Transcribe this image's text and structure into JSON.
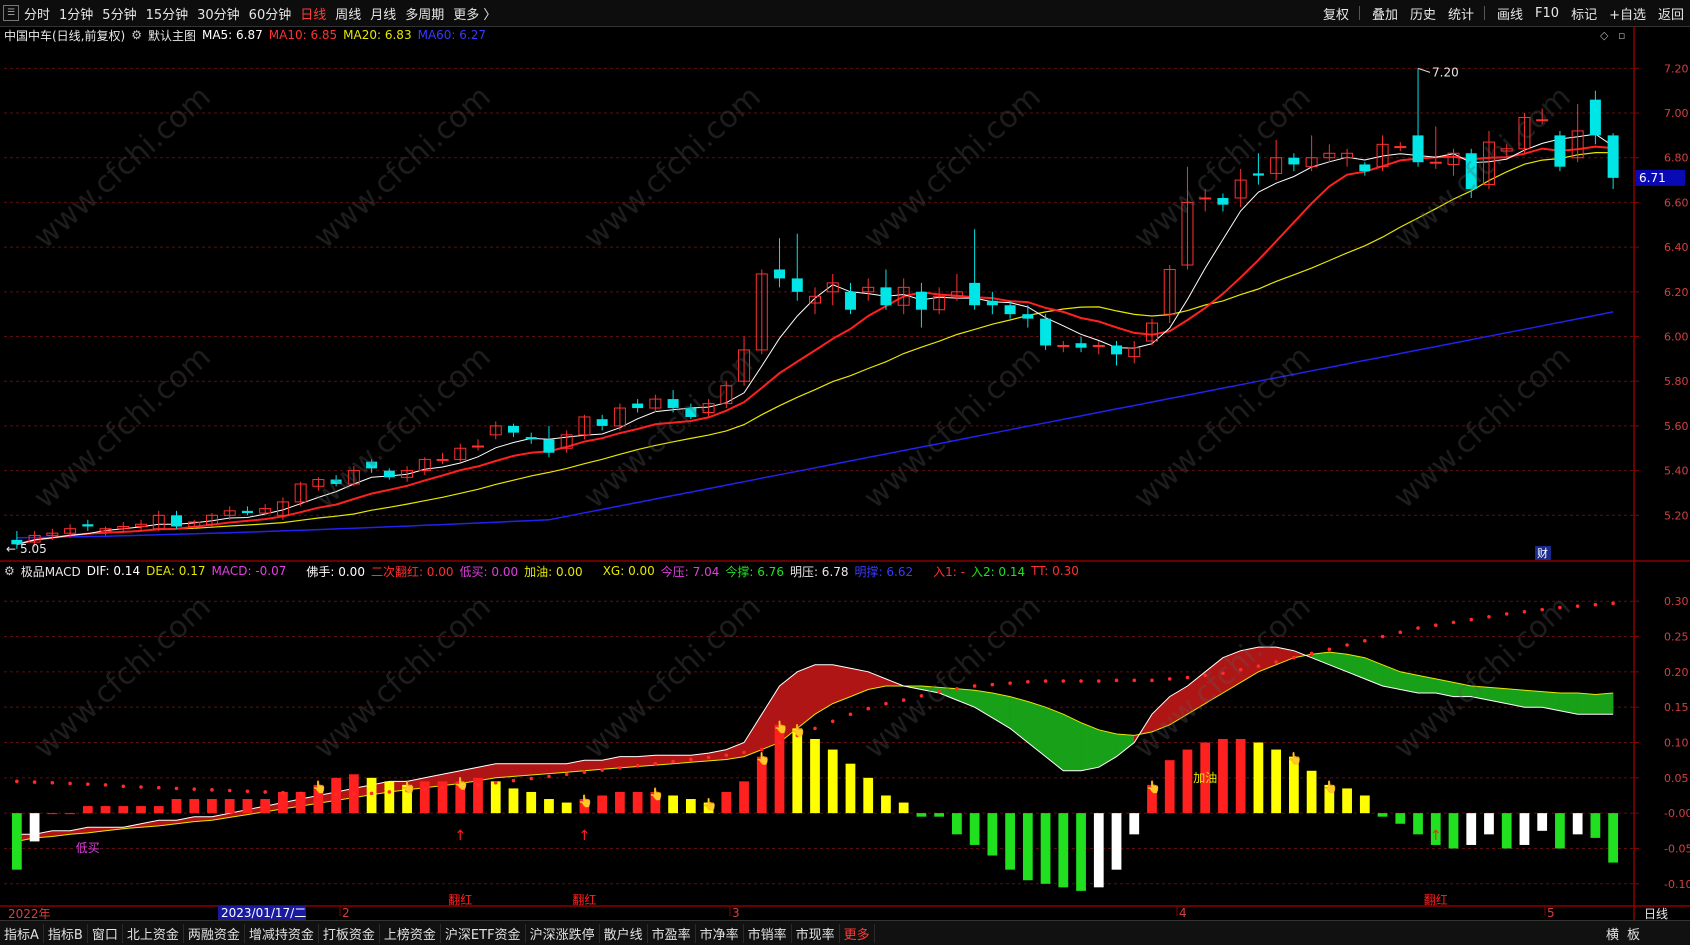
{
  "topbar": {
    "sys_icon": "menu-icon",
    "periods": [
      "分时",
      "1分钟",
      "5分钟",
      "15分钟",
      "30分钟",
      "60分钟",
      "日线",
      "周线",
      "月线",
      "多周期",
      "更多 〉"
    ],
    "active_period": "日线",
    "tools": [
      "复权",
      "叠加",
      "历史",
      "统计",
      "画线",
      "F10",
      "标记",
      "+自选",
      "返回"
    ]
  },
  "main_header": {
    "title": "中国中车(日线,前复权)",
    "indicator": "默认主图",
    "ma5": "MA5: 6.87",
    "ma10": "MA10: 6.85",
    "ma20": "MA20: 6.83",
    "ma60": "MA60: 6.27",
    "colors": {
      "ma5": "#ffffff",
      "ma10": "#ff2020",
      "ma20": "#e6e600",
      "ma60": "#2020ff"
    }
  },
  "main_axis": {
    "labels": [
      "7.20",
      "7.00",
      "6.80",
      "6.60",
      "6.40",
      "6.20",
      "6.00",
      "5.80",
      "5.60",
      "5.40",
      "5.20"
    ],
    "ymin": 5.0,
    "ymax": 7.3
  },
  "price_tag": "6.71",
  "max_label": "7.20",
  "min_label": "5.05",
  "fin_badge": "财",
  "watermark": "www.cfchi.com",
  "macd_header": {
    "name": "极品MACD",
    "dif": "DIF: 0.14",
    "dea": "DEA: 0.17",
    "macd": "MACD: -0.07",
    "foshou": "佛手: 0.00",
    "erci": "二次翻红: 0.00",
    "dimai": "低买: 0.00",
    "jiayou": "加油: 0.00",
    "xg": "XG: 0.00",
    "jinya": "今压: 7.04",
    "jincheng": "今撑: 6.76",
    "mingya": "明压: 6.78",
    "mingcheng": "明撑: 6.62",
    "ru1": "入1: -",
    "ru2": "入2: 0.14",
    "tt": "TT: 0.30"
  },
  "macd_axis": {
    "labels": [
      "0.30",
      "0.25",
      "0.20",
      "0.15",
      "0.10",
      "0.05",
      "-0.00",
      "-0.05",
      "-0.10"
    ],
    "ymin": -0.13,
    "ymax": 0.33
  },
  "macd_marks": {
    "dimai": "低买",
    "jiayou": "加油",
    "fanhong": "翻红"
  },
  "time_axis": {
    "start": "2022年",
    "cursor": "2023/01/17/二",
    "months": [
      "2",
      "3",
      "4",
      "5"
    ],
    "period_label": "日线"
  },
  "bottombar": {
    "items": [
      "指标A",
      "指标B",
      "窗口",
      "北上资金",
      "两融资金",
      "增减持资金",
      "打板资金",
      "上榜资金",
      "沪深ETF资金",
      "沪深涨跌停",
      "散户线",
      "市盈率",
      "市净率",
      "市销率",
      "市现率",
      "更多"
    ],
    "right": [
      "横",
      "板"
    ]
  },
  "chart_data": {
    "type": "candlestick",
    "title": "中国中车(日线,前复权)",
    "x_start": "2022年",
    "candles": [
      [
        5.09,
        5.07,
        5.13,
        5.05
      ],
      [
        5.08,
        5.11,
        5.13,
        5.06
      ],
      [
        5.11,
        5.12,
        5.14,
        5.09
      ],
      [
        5.12,
        5.14,
        5.16,
        5.1
      ],
      [
        5.16,
        5.15,
        5.18,
        5.13
      ],
      [
        5.13,
        5.14,
        5.15,
        5.11
      ],
      [
        5.14,
        5.15,
        5.17,
        5.12
      ],
      [
        5.15,
        5.16,
        5.18,
        5.13
      ],
      [
        5.14,
        5.2,
        5.22,
        5.13
      ],
      [
        5.2,
        5.15,
        5.22,
        5.14
      ],
      [
        5.15,
        5.17,
        5.18,
        5.14
      ],
      [
        5.16,
        5.2,
        5.21,
        5.15
      ],
      [
        5.2,
        5.22,
        5.24,
        5.18
      ],
      [
        5.22,
        5.21,
        5.24,
        5.2
      ],
      [
        5.21,
        5.23,
        5.25,
        5.2
      ],
      [
        5.2,
        5.26,
        5.28,
        5.18
      ],
      [
        5.26,
        5.34,
        5.35,
        5.24
      ],
      [
        5.33,
        5.36,
        5.37,
        5.31
      ],
      [
        5.36,
        5.34,
        5.38,
        5.33
      ],
      [
        5.34,
        5.4,
        5.42,
        5.33
      ],
      [
        5.44,
        5.41,
        5.45,
        5.39
      ],
      [
        5.4,
        5.37,
        5.41,
        5.36
      ],
      [
        5.37,
        5.4,
        5.42,
        5.35
      ],
      [
        5.4,
        5.45,
        5.46,
        5.38
      ],
      [
        5.45,
        5.45,
        5.48,
        5.43
      ],
      [
        5.45,
        5.5,
        5.52,
        5.44
      ],
      [
        5.51,
        5.51,
        5.54,
        5.49
      ],
      [
        5.56,
        5.6,
        5.62,
        5.54
      ],
      [
        5.6,
        5.57,
        5.61,
        5.55
      ],
      [
        5.55,
        5.54,
        5.57,
        5.52
      ],
      [
        5.54,
        5.48,
        5.6,
        5.46
      ],
      [
        5.5,
        5.56,
        5.58,
        5.48
      ],
      [
        5.56,
        5.64,
        5.65,
        5.54
      ],
      [
        5.63,
        5.6,
        5.65,
        5.58
      ],
      [
        5.6,
        5.68,
        5.7,
        5.58
      ],
      [
        5.7,
        5.68,
        5.72,
        5.66
      ],
      [
        5.68,
        5.72,
        5.74,
        5.66
      ],
      [
        5.72,
        5.68,
        5.76,
        5.66
      ],
      [
        5.68,
        5.64,
        5.7,
        5.63
      ],
      [
        5.66,
        5.7,
        5.72,
        5.64
      ],
      [
        5.7,
        5.78,
        5.8,
        5.68
      ],
      [
        5.8,
        5.94,
        6.0,
        5.78
      ],
      [
        5.94,
        6.28,
        6.3,
        5.92
      ],
      [
        6.3,
        6.26,
        6.44,
        6.22
      ],
      [
        6.26,
        6.2,
        6.46,
        6.16
      ],
      [
        6.15,
        6.18,
        6.22,
        6.1
      ],
      [
        6.2,
        6.24,
        6.28,
        6.14
      ],
      [
        6.2,
        6.12,
        6.24,
        6.1
      ],
      [
        6.2,
        6.22,
        6.26,
        6.16
      ],
      [
        6.22,
        6.14,
        6.3,
        6.12
      ],
      [
        6.14,
        6.22,
        6.26,
        6.1
      ],
      [
        6.2,
        6.12,
        6.24,
        6.04
      ],
      [
        6.12,
        6.18,
        6.22,
        6.1
      ],
      [
        6.18,
        6.2,
        6.28,
        6.16
      ],
      [
        6.24,
        6.14,
        6.48,
        6.12
      ],
      [
        6.16,
        6.14,
        6.2,
        6.1
      ],
      [
        6.14,
        6.1,
        6.16,
        6.08
      ],
      [
        6.1,
        6.08,
        6.14,
        6.04
      ],
      [
        6.08,
        5.96,
        6.1,
        5.94
      ],
      [
        5.96,
        5.96,
        5.98,
        5.93
      ],
      [
        5.97,
        5.95,
        6.0,
        5.93
      ],
      [
        5.96,
        5.96,
        5.98,
        5.92
      ],
      [
        5.96,
        5.92,
        5.98,
        5.87
      ],
      [
        5.91,
        5.95,
        5.98,
        5.88
      ],
      [
        5.98,
        6.06,
        6.08,
        5.96
      ],
      [
        6.1,
        6.3,
        6.32,
        6.06
      ],
      [
        6.32,
        6.6,
        6.76,
        6.3
      ],
      [
        6.62,
        6.62,
        6.66,
        6.56
      ],
      [
        6.62,
        6.59,
        6.64,
        6.56
      ],
      [
        6.62,
        6.7,
        6.75,
        6.58
      ],
      [
        6.73,
        6.72,
        6.82,
        6.68
      ],
      [
        6.73,
        6.8,
        6.88,
        6.7
      ],
      [
        6.8,
        6.77,
        6.82,
        6.74
      ],
      [
        6.76,
        6.8,
        6.9,
        6.74
      ],
      [
        6.8,
        6.82,
        6.86,
        6.78
      ],
      [
        6.8,
        6.82,
        6.84,
        6.76
      ],
      [
        6.77,
        6.74,
        6.78,
        6.72
      ],
      [
        6.76,
        6.86,
        6.9,
        6.74
      ],
      [
        6.85,
        6.85,
        6.87,
        6.83
      ],
      [
        6.9,
        6.78,
        7.2,
        6.76
      ],
      [
        6.78,
        6.78,
        6.94,
        6.75
      ],
      [
        6.77,
        6.82,
        6.84,
        6.72
      ],
      [
        6.82,
        6.66,
        6.84,
        6.62
      ],
      [
        6.68,
        6.87,
        6.92,
        6.66
      ],
      [
        6.83,
        6.84,
        6.86,
        6.8
      ],
      [
        6.84,
        6.98,
        7.0,
        6.82
      ],
      [
        6.97,
        6.97,
        7.02,
        6.95
      ],
      [
        6.9,
        6.76,
        6.92,
        6.74
      ],
      [
        6.8,
        6.92,
        7.04,
        6.78
      ],
      [
        7.06,
        6.9,
        7.1,
        6.86
      ],
      [
        6.9,
        6.71,
        6.91,
        6.66
      ]
    ],
    "macd_hist": [
      -0.08,
      -0.04,
      0.0,
      0.0,
      0.01,
      0.01,
      0.01,
      0.01,
      0.01,
      0.02,
      0.02,
      0.02,
      0.02,
      0.02,
      0.02,
      0.03,
      0.03,
      0.04,
      0.05,
      0.055,
      0.05,
      0.045,
      0.04,
      0.045,
      0.045,
      0.045,
      0.05,
      0.045,
      0.035,
      0.03,
      0.02,
      0.015,
      0.02,
      0.025,
      0.03,
      0.03,
      0.03,
      0.025,
      0.02,
      0.015,
      0.03,
      0.045,
      0.08,
      0.125,
      0.12,
      0.105,
      0.09,
      0.07,
      0.05,
      0.025,
      0.015,
      -0.005,
      -0.005,
      -0.03,
      -0.045,
      -0.06,
      -0.08,
      -0.095,
      -0.1,
      -0.105,
      -0.11,
      -0.105,
      -0.08,
      -0.03,
      0.04,
      0.075,
      0.09,
      0.1,
      0.105,
      0.105,
      0.1,
      0.09,
      0.08,
      0.06,
      0.04,
      0.035,
      0.025,
      -0.005,
      -0.015,
      -0.03,
      -0.045,
      -0.05,
      -0.045,
      -0.03,
      -0.05,
      -0.045,
      -0.025,
      -0.05,
      -0.03,
      -0.035,
      -0.07
    ],
    "dif": [
      -0.03,
      -0.03,
      -0.025,
      -0.025,
      -0.02,
      -0.02,
      -0.02,
      -0.015,
      -0.01,
      -0.01,
      -0.005,
      -0.005,
      0.0,
      0.005,
      0.01,
      0.015,
      0.02,
      0.025,
      0.03,
      0.035,
      0.04,
      0.045,
      0.045,
      0.05,
      0.055,
      0.06,
      0.065,
      0.07,
      0.07,
      0.07,
      0.07,
      0.07,
      0.075,
      0.075,
      0.08,
      0.08,
      0.082,
      0.082,
      0.082,
      0.085,
      0.09,
      0.1,
      0.14,
      0.18,
      0.2,
      0.21,
      0.21,
      0.205,
      0.2,
      0.19,
      0.18,
      0.175,
      0.17,
      0.16,
      0.15,
      0.135,
      0.12,
      0.1,
      0.08,
      0.06,
      0.06,
      0.065,
      0.08,
      0.1,
      0.14,
      0.165,
      0.18,
      0.2,
      0.22,
      0.23,
      0.235,
      0.235,
      0.23,
      0.22,
      0.21,
      0.2,
      0.19,
      0.18,
      0.175,
      0.17,
      0.17,
      0.165,
      0.165,
      0.16,
      0.155,
      0.15,
      0.15,
      0.145,
      0.14,
      0.14,
      0.14
    ],
    "dea": [
      -0.04,
      -0.035,
      -0.033,
      -0.03,
      -0.028,
      -0.025,
      -0.022,
      -0.02,
      -0.018,
      -0.015,
      -0.012,
      -0.01,
      -0.006,
      -0.002,
      0.002,
      0.006,
      0.01,
      0.014,
      0.018,
      0.022,
      0.026,
      0.03,
      0.033,
      0.036,
      0.039,
      0.042,
      0.046,
      0.05,
      0.052,
      0.054,
      0.056,
      0.058,
      0.06,
      0.062,
      0.064,
      0.066,
      0.068,
      0.07,
      0.072,
      0.074,
      0.076,
      0.08,
      0.09,
      0.1,
      0.12,
      0.14,
      0.155,
      0.165,
      0.175,
      0.18,
      0.18,
      0.18,
      0.178,
      0.176,
      0.174,
      0.17,
      0.165,
      0.158,
      0.15,
      0.14,
      0.128,
      0.118,
      0.112,
      0.11,
      0.115,
      0.125,
      0.14,
      0.155,
      0.17,
      0.185,
      0.2,
      0.21,
      0.22,
      0.225,
      0.228,
      0.225,
      0.22,
      0.21,
      0.2,
      0.195,
      0.19,
      0.185,
      0.18,
      0.178,
      0.176,
      0.174,
      0.172,
      0.17,
      0.17,
      0.168,
      0.17
    ],
    "red_dots": [
      0.045,
      0.044,
      0.043,
      0.042,
      0.041,
      0.04,
      0.038,
      0.037,
      0.036,
      0.035,
      0.034,
      0.033,
      0.032,
      0.031,
      0.03,
      0.029,
      0.028,
      0.028,
      0.027,
      0.027,
      0.028,
      0.03,
      0.032,
      0.034,
      0.036,
      0.038,
      0.04,
      0.043,
      0.046,
      0.049,
      0.052,
      0.055,
      0.058,
      0.061,
      0.064,
      0.067,
      0.07,
      0.073,
      0.076,
      0.079,
      0.082,
      0.086,
      0.09,
      0.1,
      0.11,
      0.12,
      0.13,
      0.14,
      0.148,
      0.155,
      0.16,
      0.166,
      0.172,
      0.176,
      0.18,
      0.182,
      0.184,
      0.186,
      0.187,
      0.187,
      0.187,
      0.187,
      0.188,
      0.188,
      0.188,
      0.19,
      0.192,
      0.195,
      0.198,
      0.203,
      0.208,
      0.214,
      0.22,
      0.226,
      0.232,
      0.238,
      0.244,
      0.25,
      0.256,
      0.262,
      0.266,
      0.27,
      0.274,
      0.278,
      0.282,
      0.285,
      0.288,
      0.291,
      0.293,
      0.295,
      0.297
    ]
  }
}
